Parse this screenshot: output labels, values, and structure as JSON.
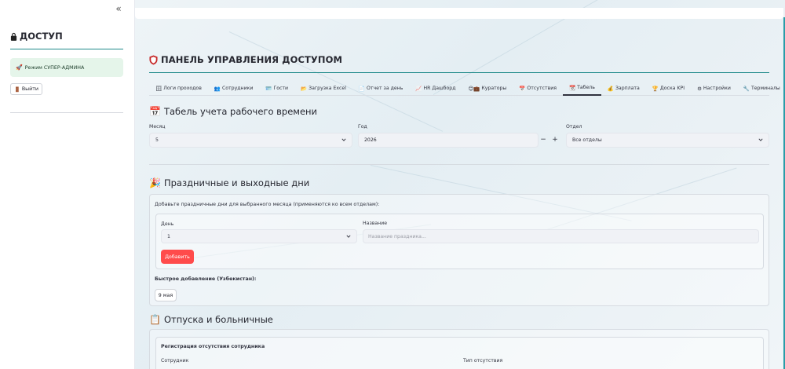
{
  "sidebar": {
    "collapse_label": "«",
    "title": "ДОСТУП",
    "mode_label": "Режим СУПЕР-АДМИНА",
    "logout_label": "Выйти"
  },
  "header": {
    "title": "ПАНЕЛЬ УПРАВЛЕНИЯ ДОСТУПОМ"
  },
  "tabs": [
    {
      "icon": "🗄",
      "label": "Логи проходов"
    },
    {
      "icon": "👥",
      "label": "Сотрудники"
    },
    {
      "icon": "🪪",
      "label": "Гости"
    },
    {
      "icon": "📂",
      "label": "Загрузка Excel"
    },
    {
      "icon": "📄",
      "label": "Отчет за день"
    },
    {
      "icon": "📈",
      "label": "HR Дашборд"
    },
    {
      "icon": "😊💼",
      "label": "Кураторы"
    },
    {
      "icon": "📅",
      "label": "Отсутствия"
    },
    {
      "icon": "📆",
      "label": "Табель"
    },
    {
      "icon": "💰",
      "label": "Зарплата"
    },
    {
      "icon": "🏆",
      "label": "Доска KPI"
    },
    {
      "icon": "⚙",
      "label": "Настройки"
    },
    {
      "icon": "🔧",
      "label": "Терминалы"
    }
  ],
  "timesheet": {
    "title": "Табель учета рабочего времени",
    "month_label": "Месяц",
    "month_value": "5",
    "year_label": "Год",
    "year_value": "2026",
    "minus": "−",
    "plus": "+",
    "dept_label": "Отдел",
    "dept_value": "Все отделы"
  },
  "holidays": {
    "title": "Праздничные и выходные дни",
    "hint": "Добавьте праздничные дни для выбранного месяца (применяются ко всем отделам):",
    "day_label": "День",
    "day_value": "1",
    "name_label": "Название",
    "name_placeholder": "Название праздника...",
    "add_button": "Добавить",
    "quick_label": "Быстрое добавление (Узбекистан):",
    "quick_button": "9 мая"
  },
  "absences": {
    "title": "Отпуска и больничные",
    "form_title": "Регистрация отсутствия сотрудника",
    "employee_label": "Сотрудник",
    "type_label": "Тип отсутствия"
  },
  "colors": {
    "accent_teal": "#1f8a8a",
    "button_red": "#ff4b4b",
    "success_bg": "#e5f5ea"
  }
}
